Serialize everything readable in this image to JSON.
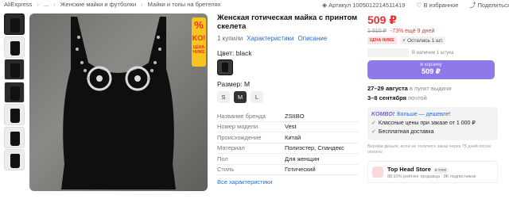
{
  "breadcrumb": [
    "AliExpress",
    "...",
    "Женские майки и футболки",
    "Майки и топы на бретелях"
  ],
  "header": {
    "article": "Артикул 1005012214511419",
    "favorites": "В избранное",
    "share": "Поделиться"
  },
  "gallery": {
    "thumbnail_count": 7,
    "badge": {
      "percent": "%",
      "logo": "KO!",
      "text": "ЦЕНА НИЖЕ"
    }
  },
  "product": {
    "title": "Женская готическая майка с принтом скелета",
    "bought": "1 купили",
    "characteristics_link": "Характеристики",
    "description_link": "Описание",
    "color_label": "Цвет: black",
    "size_label": "Размер: M",
    "sizes": [
      "S",
      "M",
      "L"
    ],
    "selected_size": "M",
    "specs": [
      {
        "key": "Название бренда",
        "value": "ZSIIBO"
      },
      {
        "key": "Номер модели",
        "value": "Vest"
      },
      {
        "key": "Происхождение",
        "value": "Китай"
      },
      {
        "key": "Материал",
        "value": "Полиэстер, Спандекс"
      },
      {
        "key": "Пол",
        "value": "Для женщин"
      },
      {
        "key": "Стиль",
        "value": "Готический"
      }
    ],
    "all_characteristics": "Все характеристики"
  },
  "buy": {
    "price": "509 ₽",
    "old_price": "1 910 ₽",
    "discount": "-73% ещё 9 дней",
    "chip_price_lower": "ЦЕНА НИЖЕ",
    "chip_left": "Осталась 1 шт.",
    "qty_note": "В наличии 1 штука",
    "cart_line1": "В корзину",
    "cart_line2": "509 ₽",
    "delivery1_date": "27–29 августа",
    "delivery1_mode": "в пункт выдачи",
    "delivery2_date": "3–8 сентября",
    "delivery2_mode": "почтой",
    "promo_header": "Больше — дешевле!",
    "promo_logo": "KOMBO!",
    "promo_item1": "Классные цены при заказе от 1 000 ₽",
    "promo_item2": "Бесплатная доставка",
    "refund_note": "Вернём деньги, если не получите заказ через 75 дней после оплаты",
    "store_name": "Top Head Store",
    "store_tag": "в топе",
    "store_sub": "88,93% рейтинг продавца · 8K подписчиков"
  },
  "colors": {
    "accent": "#e8322d",
    "button": "#8f79ea",
    "link": "#2a6bd6"
  }
}
